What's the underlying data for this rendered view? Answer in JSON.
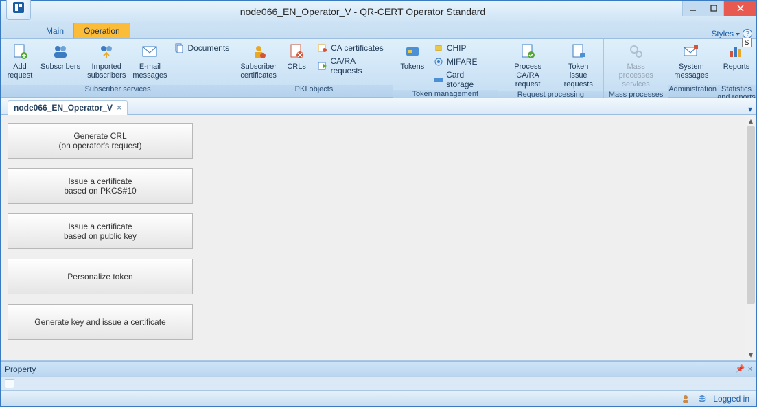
{
  "window": {
    "title": "node066_EN_Operator_V - QR-CERT Operator Standard"
  },
  "menu": {
    "main": "Main",
    "operation": "Operation",
    "styles": "Styles",
    "key_hint": "S"
  },
  "ribbon": {
    "subscriber_services": {
      "title": "Subscriber services",
      "add_request": "Add\nrequest",
      "subscribers": "Subscribers",
      "imported_subscribers": "Imported\nsubscribers",
      "email_messages": "E-mail\nmessages",
      "documents": "Documents"
    },
    "pki_objects": {
      "title": "PKI objects",
      "subscriber_certificates": "Subscriber\ncertificates",
      "crls": "CRLs",
      "ca_certificates": "CA certificates",
      "cara_requests": "CA/RA requests"
    },
    "token_management": {
      "title": "Token management",
      "tokens": "Tokens",
      "chip": "CHIP",
      "mifare": "MIFARE",
      "card_storage": "Card storage"
    },
    "request_processing": {
      "title": "Request processing",
      "process_cara": "Process\nCA/RA request",
      "token_issue": "Token issue\nrequests"
    },
    "mass_processes": {
      "title": "Mass processes",
      "mass_services": "Mass processes\nservices"
    },
    "administration": {
      "title": "Administration",
      "system_messages": "System\nmessages"
    },
    "statistics": {
      "title": "Statistics and reports",
      "reports": "Reports"
    }
  },
  "document_tab": {
    "label": "node066_EN_Operator_V"
  },
  "actions": {
    "generate_crl_l1": "Generate CRL",
    "generate_crl_l2": "(on operator's request)",
    "issue_pkcs_l1": "Issue a certificate",
    "issue_pkcs_l2": "based on PKCS#10",
    "issue_pubkey_l1": "Issue a certificate",
    "issue_pubkey_l2": "based on public key",
    "personalize": "Personalize token",
    "gen_key_issue": "Generate key and issue a certificate"
  },
  "property": {
    "title": "Property"
  },
  "status": {
    "logged_in": "Logged in"
  }
}
